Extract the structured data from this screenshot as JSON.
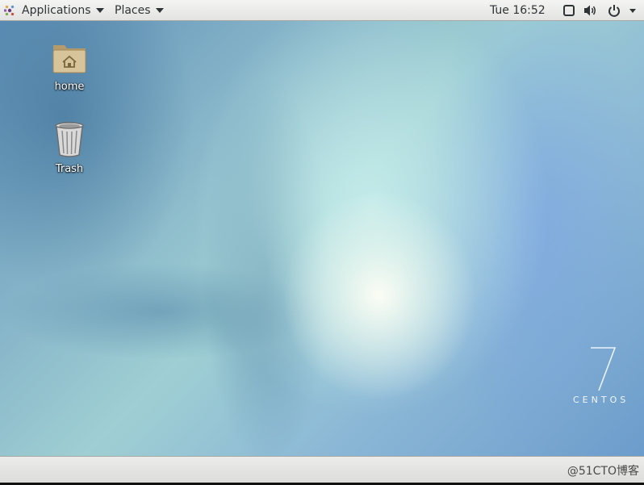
{
  "top_panel": {
    "applications_label": "Applications",
    "places_label": "Places",
    "clock": "Tue 16:52",
    "tray_icons": [
      "screen-icon",
      "volume-icon",
      "power-icon",
      "chevron-down-icon"
    ]
  },
  "desktop": {
    "icons": [
      {
        "label": "home",
        "icon": "home-folder-icon"
      },
      {
        "label": "Trash",
        "icon": "trash-icon"
      }
    ],
    "branding": {
      "version": "7",
      "name": "CENTOS"
    }
  },
  "bottom_panel": {
    "watermark": "@51CTO博客"
  },
  "colors": {
    "panel": "#e9e9e7",
    "panel_text": "#2e3436",
    "desktop_accent": "#89b7ca"
  }
}
